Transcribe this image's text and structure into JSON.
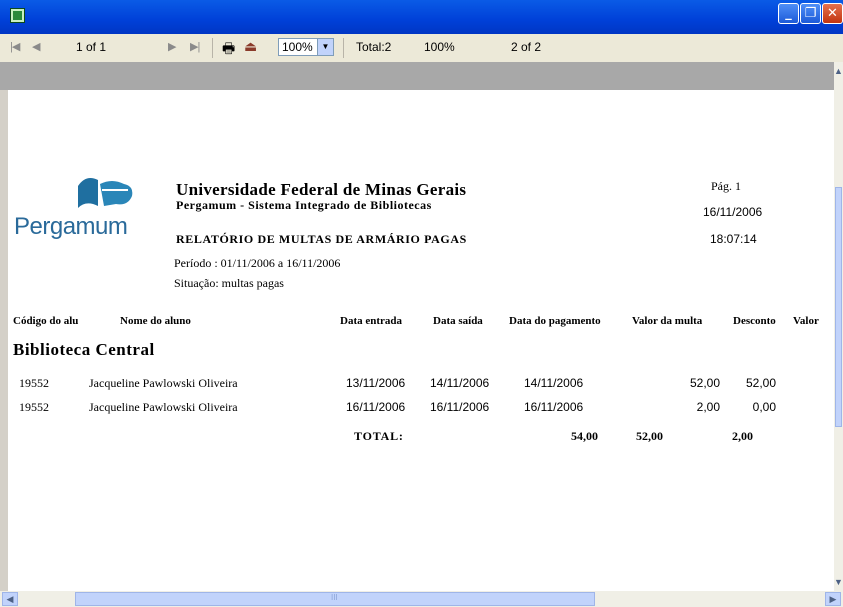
{
  "window": {
    "title": "",
    "minimize": "_",
    "restore": "❐",
    "close": "✕"
  },
  "toolbar": {
    "page_indicator": "1 of 1",
    "zoom": "100%",
    "total": "Total:2",
    "percent": "100%",
    "records": "2 of 2"
  },
  "report": {
    "logo_text": "Pergamum",
    "institution": "Universidade Federal de Minas Gerais",
    "system": "Pergamum - Sistema Integrado de Bibliotecas",
    "title": "RELATÓRIO DE MULTAS DE ARMÁRIO PAGAS",
    "period": "Período : 01/11/2006 a 16/11/2006",
    "situation": "Situação: multas pagas",
    "page": "Pág. 1",
    "date": "16/11/2006",
    "time": "18:07:14",
    "columns": [
      "Código  do alu",
      "Nome do aluno",
      "Data entrada",
      "Data saída",
      "Data do pagamento",
      "Valor da multa",
      "Desconto",
      "Valor"
    ],
    "library": "Biblioteca Central",
    "rows": [
      {
        "code": "19552",
        "name": "Jacqueline Pawlowski Oliveira",
        "entry": "13/11/2006",
        "exit": "14/11/2006",
        "payment": "14/11/2006",
        "fine": "52,00",
        "discount": "52,00"
      },
      {
        "code": "19552",
        "name": "Jacqueline Pawlowski Oliveira",
        "entry": "16/11/2006",
        "exit": "16/11/2006",
        "payment": "16/11/2006",
        "fine": "2,00",
        "discount": "0,00"
      }
    ],
    "total_label": "TOTAL:",
    "total_fine": "54,00",
    "total_discount": "52,00",
    "total_value": "2,00"
  },
  "scroll": {
    "hgrip": "III"
  }
}
